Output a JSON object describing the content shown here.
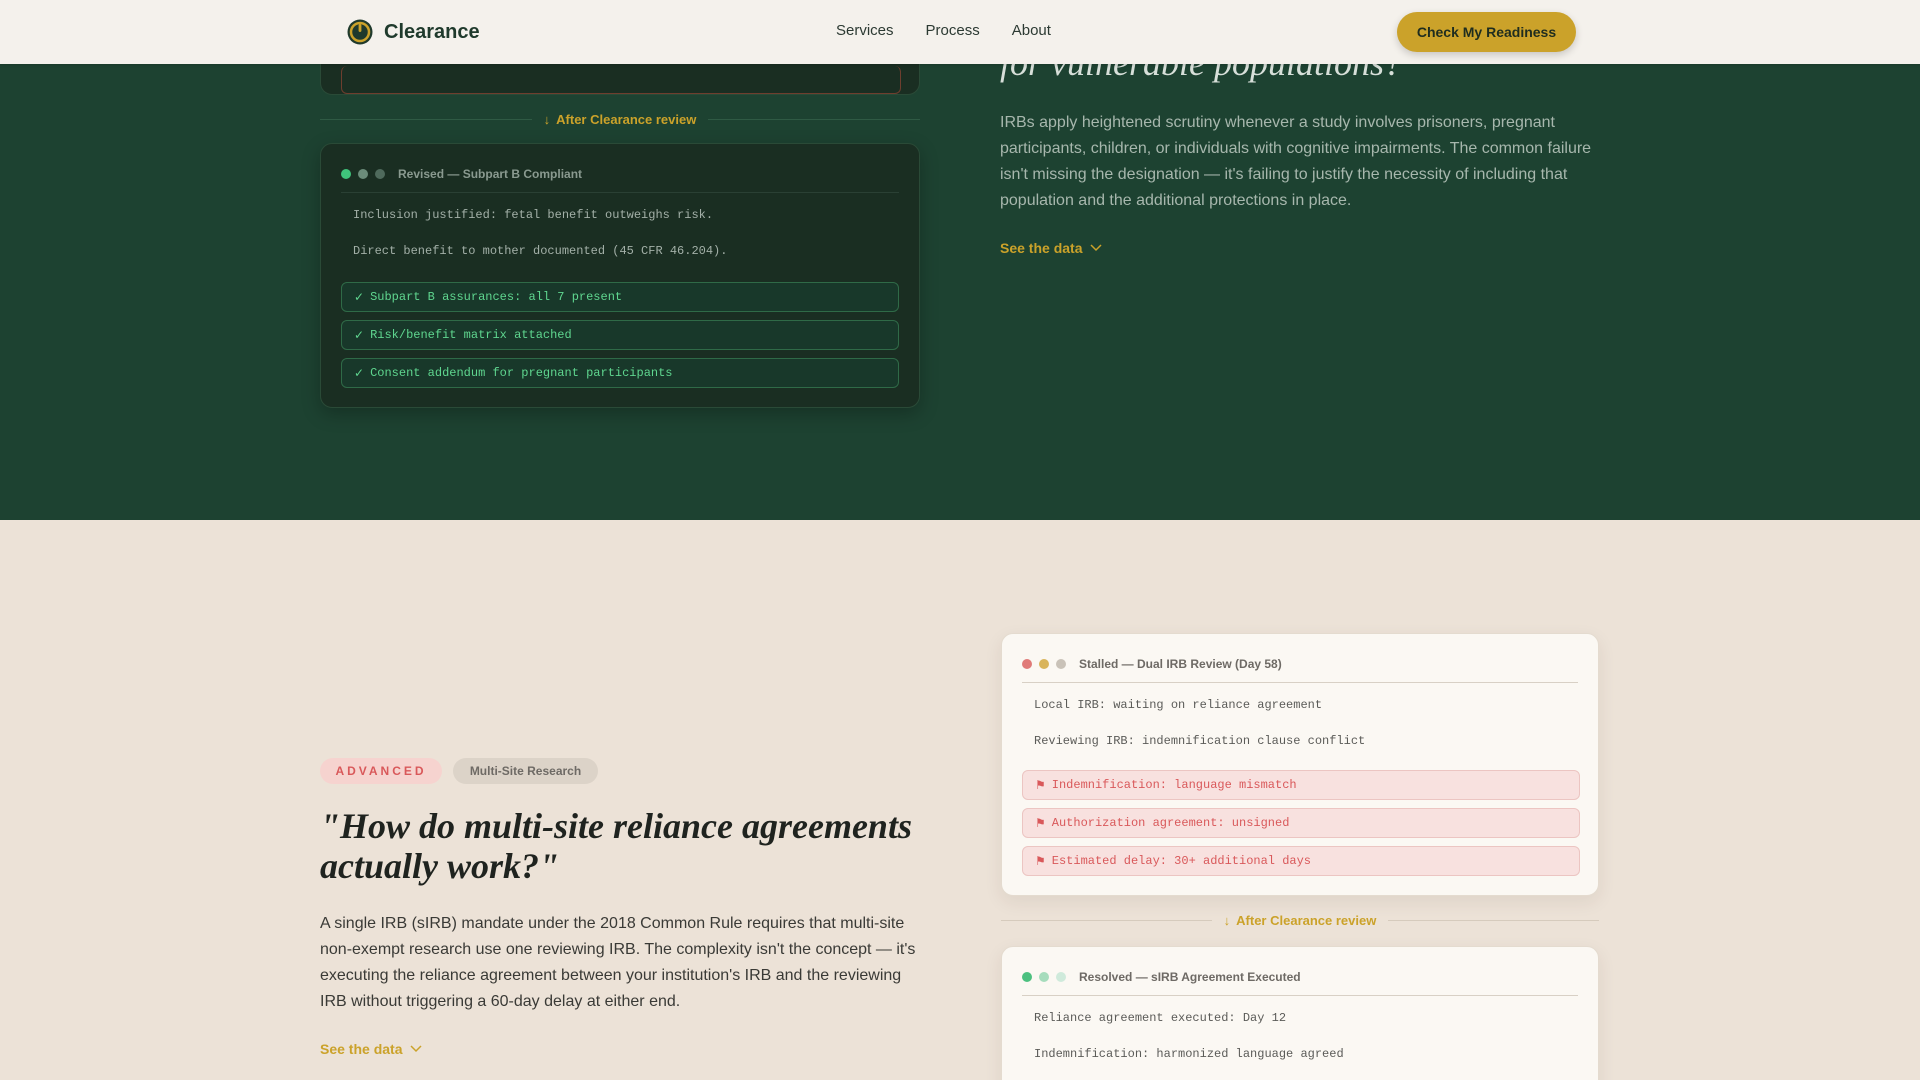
{
  "nav": {
    "brand": "Clearance",
    "links": [
      "Services",
      "Process",
      "About"
    ],
    "cta": "Check My Readiness"
  },
  "dark_section": {
    "divider_label": "After Clearance review",
    "card": {
      "title": "Revised — Subpart B Compliant",
      "dot_colors": [
        "#3fc47b",
        "#6b8c7a",
        "#4f6a5c"
      ],
      "lines": [
        "Inclusion justified: fetal benefit outweighs risk.",
        "Direct benefit to mother documented (45 CFR 46.204)."
      ],
      "checks": [
        "Subpart B assurances: all 7 present",
        "Risk/benefit matrix attached",
        "Consent addendum for pregnant participants"
      ],
      "check_glyph": "✓"
    },
    "right": {
      "heading_fragment": "for vulnerable populations?",
      "body": "IRBs apply heightened scrutiny whenever a study involves prisoners, pregnant participants, children, or individuals with cognitive impairments. The common failure isn't missing the designation — it's failing to justify the necessity of including that population and the additional protections in place.",
      "see_data": "See the data"
    }
  },
  "light_section": {
    "tags": [
      "ADVANCED",
      "Multi-Site Research"
    ],
    "title": "\"How do multi-site reliance agreements actually work?\"",
    "body": "A single IRB (sIRB) mandate under the 2018 Common Rule requires that multi-site non-exempt research use one reviewing IRB. The complexity isn't the concept — it's executing the reliance agreement between your institution's IRB and the reviewing IRB without triggering a 60-day delay at either end.",
    "see_data": "See the data",
    "divider_label": "After Clearance review",
    "stalled_card": {
      "title": "Stalled — Dual IRB Review (Day 58)",
      "dot_colors": [
        "#e07a78",
        "#d9b45a",
        "#c9c2b8"
      ],
      "lines": [
        "Local IRB: waiting on reliance agreement",
        "Reviewing IRB: indemnification clause conflict"
      ],
      "flags": [
        "Indemnification: language mismatch",
        "Authorization agreement: unsigned",
        "Estimated delay: 30+ additional days"
      ],
      "flag_glyph": "⚑"
    },
    "resolved_card": {
      "title": "Resolved — sIRB Agreement Executed",
      "dot_colors": [
        "#4cc07f",
        "#a6dcbc",
        "#cfeadb"
      ],
      "lines": [
        "Reliance agreement executed: Day 12",
        "Indemnification: harmonized language agreed"
      ]
    }
  },
  "colors": {
    "accent": "#cba22a",
    "dark_bg": "#1d4231",
    "light_bg": "#ece2d7",
    "success": "#5fd68f",
    "danger": "#d9585a"
  }
}
